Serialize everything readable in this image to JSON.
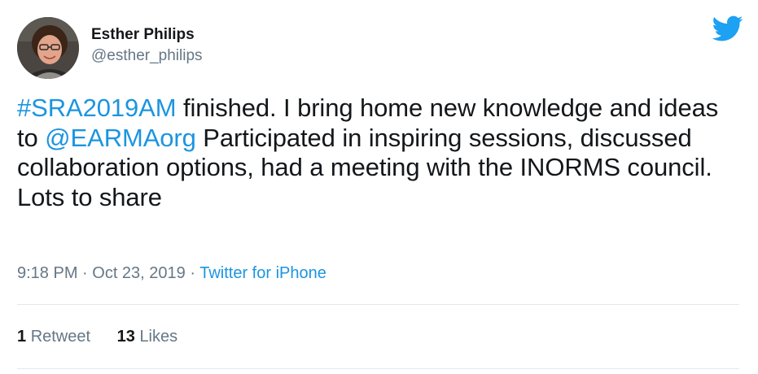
{
  "author": {
    "display_name": "Esther Philips",
    "handle": "@esther_philips"
  },
  "brand": {
    "icon": "twitter-bird-icon",
    "color": "#1da1f2"
  },
  "tweet": {
    "hashtag": "#SRA2019AM",
    "text_1": " finished. I bring home new knowledge and ideas to ",
    "mention": "@EARMAorg",
    "text_2": " Participated in inspiring sessions, discussed collaboration options, had a meeting with the INORMS council. Lots to share"
  },
  "meta": {
    "time": "9:18 PM",
    "separator": " · ",
    "date": "Oct 23, 2019",
    "source": "Twitter for iPhone"
  },
  "stats": {
    "retweets_count": "1",
    "retweets_label": "Retweet",
    "likes_count": "13",
    "likes_label": "Likes"
  },
  "colors": {
    "link": "#1b95e0",
    "text": "#14171a",
    "secondary": "#657786",
    "divider": "#e1e8ed"
  }
}
